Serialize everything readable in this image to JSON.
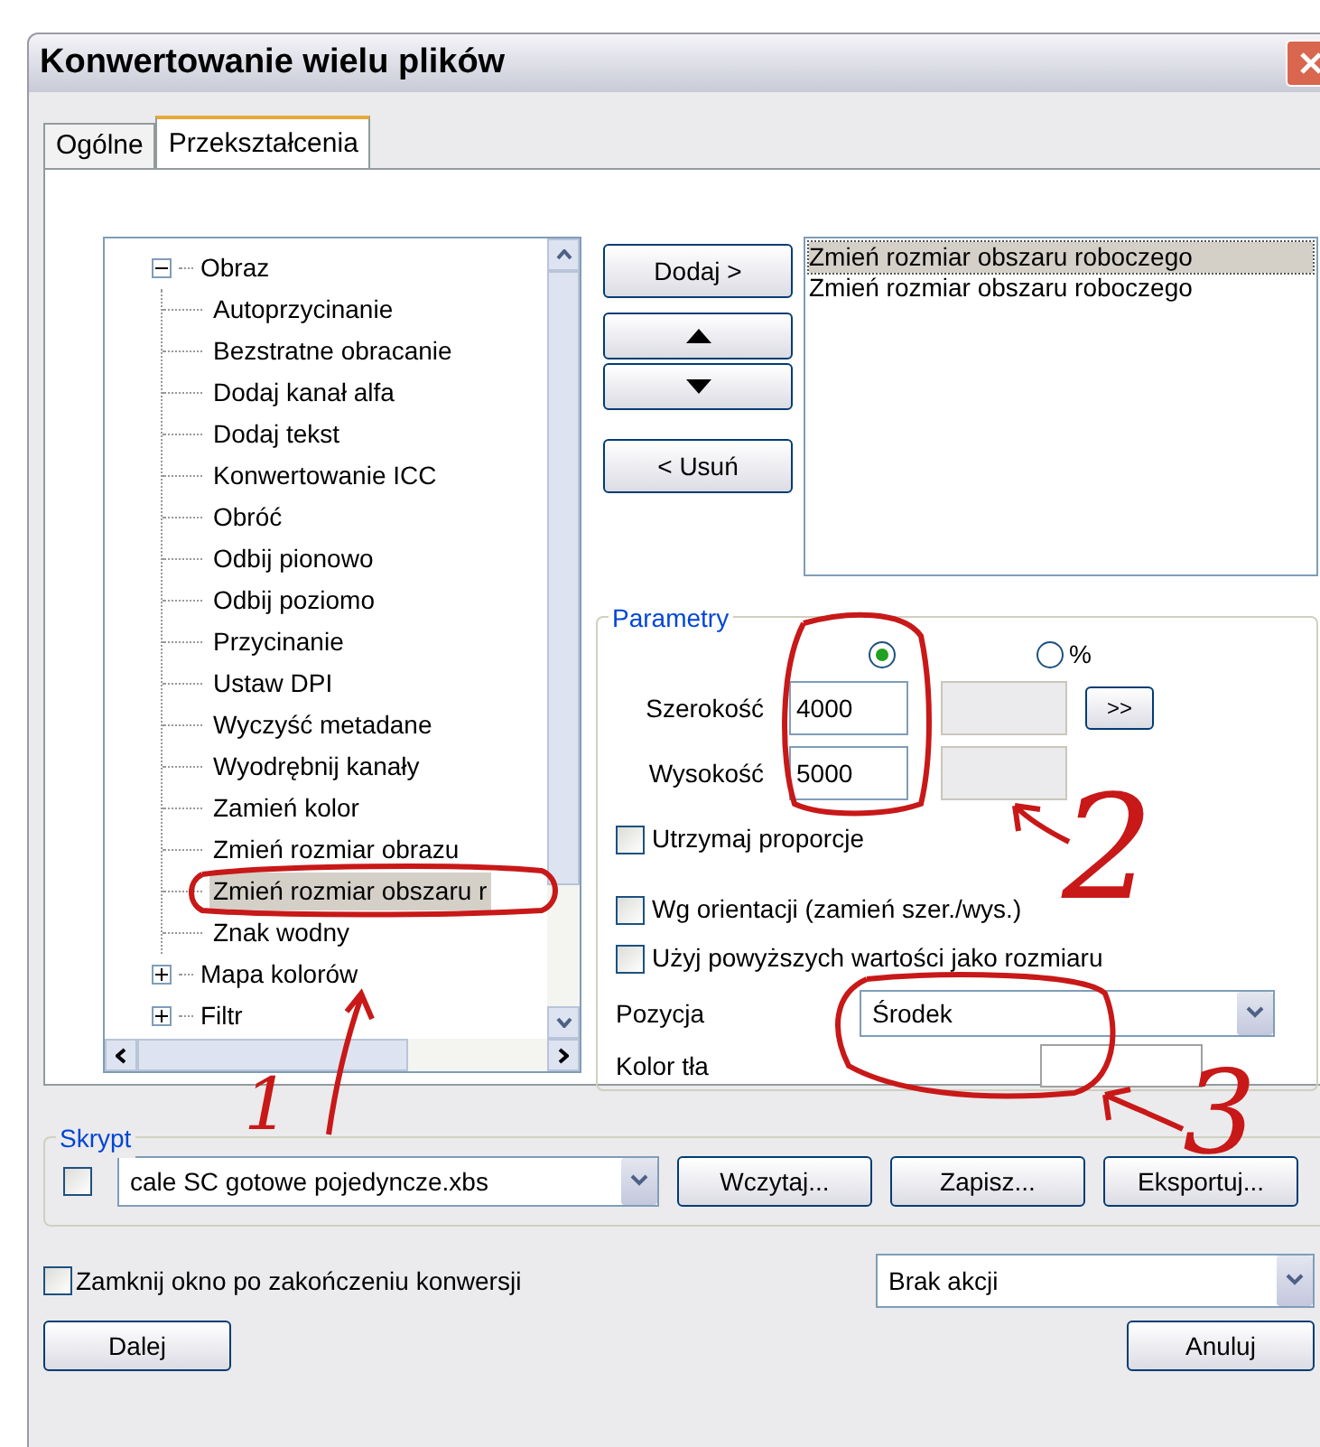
{
  "window": {
    "title": "Konwertowanie wielu plików"
  },
  "tabs": [
    {
      "label": "Ogólne",
      "selected": false
    },
    {
      "label": "Przekształcenia",
      "selected": true
    }
  ],
  "tree": {
    "items": [
      {
        "label": "Obraz",
        "expanded": true,
        "children": [
          {
            "label": "Autoprzycinanie",
            "selected": false
          },
          {
            "label": "Bezstratne obracanie",
            "selected": false
          },
          {
            "label": "Dodaj kanał alfa",
            "selected": false
          },
          {
            "label": "Dodaj tekst",
            "selected": false
          },
          {
            "label": "Konwertowanie ICC",
            "selected": false
          },
          {
            "label": "Obróć",
            "selected": false
          },
          {
            "label": "Odbij pionowo",
            "selected": false
          },
          {
            "label": "Odbij poziomo",
            "selected": false
          },
          {
            "label": "Przycinanie",
            "selected": false
          },
          {
            "label": "Ustaw DPI",
            "selected": false
          },
          {
            "label": "Wyczyść metadane",
            "selected": false
          },
          {
            "label": "Wyodrębnij kanały",
            "selected": false
          },
          {
            "label": "Zamień kolor",
            "selected": false
          },
          {
            "label": "Zmień rozmiar obrazu",
            "selected": false
          },
          {
            "label": "Zmień rozmiar obszaru r",
            "selected": true
          },
          {
            "label": "Znak wodny",
            "selected": false
          }
        ]
      },
      {
        "label": "Mapa kolorów",
        "expanded": false
      },
      {
        "label": "Filtr",
        "expanded": false
      }
    ]
  },
  "list_buttons": [
    {
      "kind": "text",
      "label": "Dodaj >"
    },
    {
      "kind": "up"
    },
    {
      "kind": "down"
    },
    {
      "kind": "text",
      "label": "< Usuń"
    }
  ],
  "transform_list": [
    {
      "label": "Zmień rozmiar obszaru roboczego",
      "selected": true
    },
    {
      "label": "Zmień rozmiar obszaru roboczego",
      "selected": false
    }
  ],
  "parameters": {
    "title": "Parametry",
    "units": [
      {
        "selected": true
      },
      {
        "label": "%",
        "selected": false
      }
    ],
    "fields": [
      {
        "label": "Szerokość",
        "value": "4000"
      },
      {
        "label": "Wysokość",
        "value": "5000"
      }
    ],
    "copy_button": ">>",
    "keep_ratio": {
      "label": "Utrzymaj proporcje",
      "checked": false
    },
    "options": [
      {
        "label": "Wg orientacji (zamień szer./wys.)",
        "checked": false
      },
      {
        "label": "Użyj powyższych wartości jako rozmiaru",
        "checked": false
      }
    ],
    "position": {
      "label": "Pozycja",
      "value": "Środek"
    },
    "background": {
      "label": "Kolor tła"
    }
  },
  "script": {
    "title": "Skrypt",
    "checked": false,
    "file": "cale SC gotowe pojedyncze.xbs",
    "buttons": [
      "Wczytaj...",
      "Zapisz...",
      "Eksportuj..."
    ]
  },
  "close_after": {
    "label": "Zamknij okno po zakończeniu konwersji",
    "checked": false
  },
  "after_action": {
    "value": "Brak akcji"
  },
  "buttons": [
    "Dalej",
    "Anuluj"
  ],
  "annotations": [
    {
      "label": "1"
    },
    {
      "label": "2"
    },
    {
      "label": "3"
    }
  ]
}
